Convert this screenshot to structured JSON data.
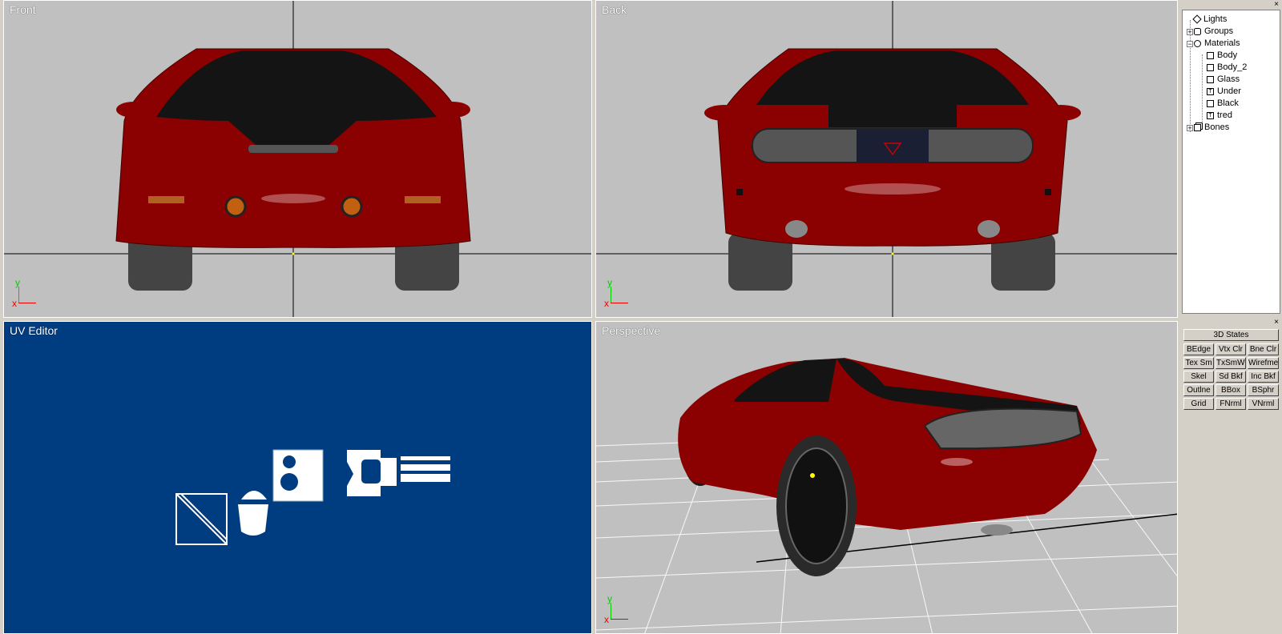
{
  "viewports": {
    "front": {
      "title": "Front"
    },
    "back": {
      "title": "Back"
    },
    "uv": {
      "title": "UV Editor"
    },
    "perspective": {
      "title": "Perspective"
    }
  },
  "axis_labels": {
    "x": "x",
    "y": "y"
  },
  "scene_tree": {
    "items": [
      {
        "label": "Lights",
        "icon": "light-icon"
      },
      {
        "label": "Groups",
        "icon": "group-icon"
      },
      {
        "label": "Materials",
        "icon": "material-icon"
      },
      {
        "label": "Body",
        "icon": "material-swatch-icon"
      },
      {
        "label": "Body_2",
        "icon": "material-swatch-icon"
      },
      {
        "label": "Glass",
        "icon": "material-swatch-icon"
      },
      {
        "label": "Under",
        "icon": "textured-material-icon"
      },
      {
        "label": "Black",
        "icon": "material-swatch-icon"
      },
      {
        "label": "tred",
        "icon": "textured-material-icon"
      },
      {
        "label": "Bones",
        "icon": "bones-icon"
      }
    ],
    "expanders": {
      "groups": "+",
      "materials": "−",
      "bones": "+"
    }
  },
  "display_panel": {
    "title_button": "3D States",
    "buttons": [
      [
        "BEdge",
        "Vtx Clr",
        "Bne Clr"
      ],
      [
        "Tex Sm",
        "TxSmWr",
        "Wirefme"
      ],
      [
        "Skel",
        "Sd Bkf",
        "Inc Bkf"
      ],
      [
        "Outlne",
        "BBox",
        "BSphr"
      ],
      [
        "Grid",
        "FNrml",
        "VNrml"
      ]
    ]
  },
  "close_glyph": "×",
  "colors": {
    "viewport_bg": "#c0c0c0",
    "uv_bg": "#003c80",
    "car_body": "#8b0000",
    "glass": "#141414"
  }
}
